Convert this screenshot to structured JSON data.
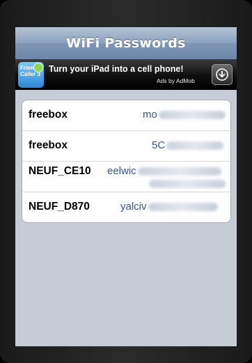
{
  "navbar": {
    "title": "WiFi Passwords"
  },
  "ad": {
    "logo_text": "Friend Caller 3",
    "headline": "Turn your iPad into a cell phone!",
    "attribution": "Ads by AdMob",
    "download_icon": "download-arrow-icon"
  },
  "networks": [
    {
      "ssid": "freebox",
      "password_visible": "mo"
    },
    {
      "ssid": "freebox",
      "password_visible": "5C"
    },
    {
      "ssid": "NEUF_CE10",
      "password_visible": "eelwic"
    },
    {
      "ssid": "NEUF_D870",
      "password_visible": "yalciv"
    }
  ]
}
